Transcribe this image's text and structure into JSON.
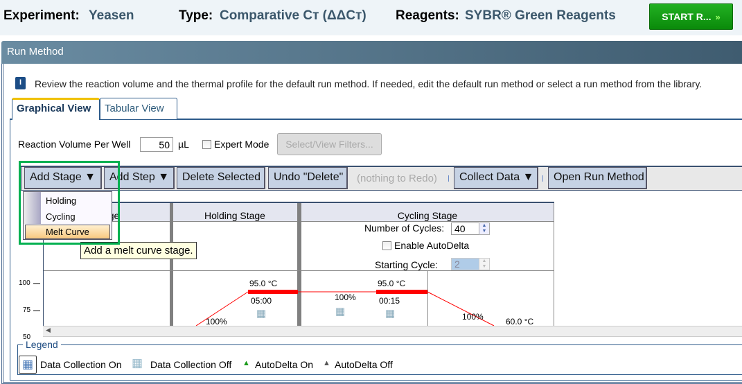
{
  "header": {
    "experiment_label": "Experiment:",
    "experiment_value": "Yeasen",
    "type_label": "Type:",
    "type_value": "Comparative Cт (ΔΔCт)",
    "reagents_label": "Reagents:",
    "reagents_value": "SYBR® Green Reagents",
    "start_button": "START R..."
  },
  "panel": {
    "title": "Run Method",
    "info_text": "Review the reaction volume and the thermal profile for the default run method. If needed, edit the default run method or select a run method from the library."
  },
  "tabs": [
    {
      "label": "Graphical View",
      "active": true
    },
    {
      "label": "Tabular View",
      "active": false
    }
  ],
  "settings": {
    "volume_label": "Reaction Volume Per Well",
    "volume_value": "50",
    "volume_unit": "µL",
    "expert_mode_label": "Expert Mode",
    "expert_mode_checked": false,
    "filters_button": "Select/View Filters..."
  },
  "toolbar": {
    "add_stage": "Add Stage ▼",
    "add_step": "Add Step ▼",
    "delete_selected": "Delete Selected",
    "undo": "Undo \"Delete\"",
    "redo": "(nothing to Redo)",
    "collect_data": "Collect Data ▼",
    "open_run_method": "Open Run Method"
  },
  "add_stage_menu": {
    "items": [
      "Holding",
      "Cycling",
      "Melt Curve"
    ],
    "selected": "Melt Curve",
    "tooltip": "Add a melt curve stage."
  },
  "stages": {
    "first_partial": "Stage",
    "holding": "Holding Stage",
    "cycling": "Cycling Stage",
    "cycles_label": "Number of Cycles:",
    "cycles_value": "40",
    "autodelta_label": "Enable AutoDelta",
    "autodelta_checked": false,
    "starting_cycle_label": "Starting Cycle:",
    "starting_cycle_value": "2"
  },
  "profile": {
    "y_ticks": [
      "100",
      "75",
      "50"
    ],
    "holding_temp": "95.0 °C",
    "holding_time": "05:00",
    "holding_ramp": "100%",
    "cycling_ramp1": "100%",
    "cycling_temp1": "95.0 °C",
    "cycling_time1": "00:15",
    "cycling_ramp2": "100%",
    "cycling_temp2": "60.0 °C",
    "line_color": "#ff0000"
  },
  "legend": {
    "title": "Legend",
    "items": [
      "Data Collection On",
      "Data Collection Off",
      "AutoDelta On",
      "AutoDelta Off"
    ]
  },
  "colors": {
    "start_button": "#0a8a0a",
    "selection_highlight": "#00b050"
  }
}
